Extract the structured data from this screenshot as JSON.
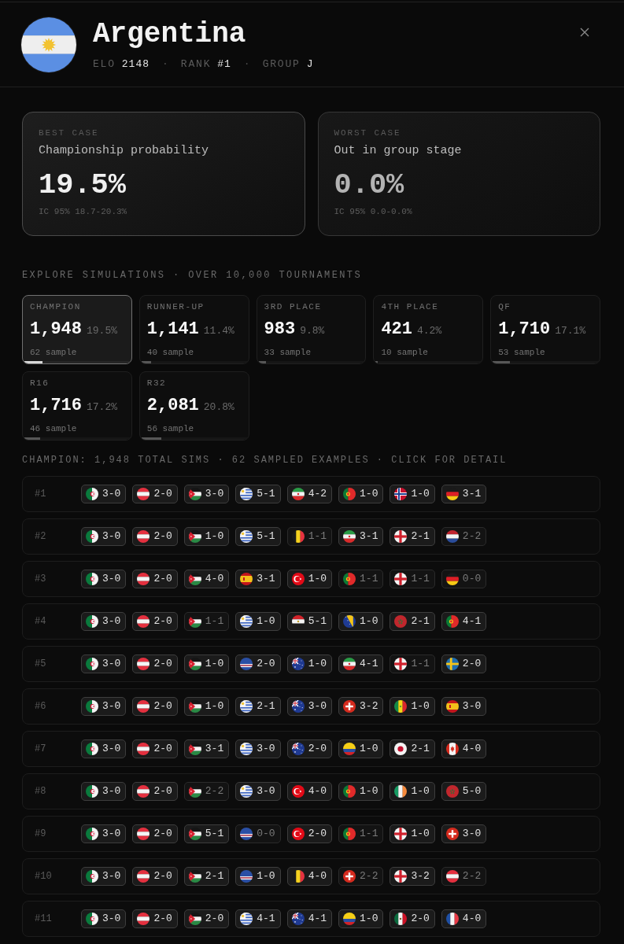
{
  "header": {
    "flag": {
      "kind": "argentina"
    },
    "title": "Argentina",
    "meta": [
      {
        "kind": "stat",
        "label": "ELO",
        "value": "2148"
      },
      {
        "kind": "separator",
        "text": "·"
      },
      {
        "kind": "stat",
        "label": "RANK",
        "value": "#1"
      },
      {
        "kind": "separator",
        "text": "·"
      },
      {
        "kind": "stat",
        "label": "GROUP",
        "value": "J"
      }
    ]
  },
  "cards": [
    {
      "kind": "best",
      "eyebrow": "BEST CASE",
      "title": "Championship probability",
      "value": "19.5%",
      "interval": "IC 95% 18.7-20.3%"
    },
    {
      "kind": "worst",
      "eyebrow": "WORST CASE",
      "title": "Out in group stage",
      "value": "0.0%",
      "interval": "IC 95% 0.0-0.0%"
    }
  ],
  "explore": {
    "heading": "EXPLORE SIMULATIONS · OVER 10,000 TOURNAMENTS",
    "tiles": [
      {
        "label": "CHAMPION",
        "count": "1,948",
        "share": "19.5%",
        "sample": "62 sample",
        "selected": true,
        "level": 0.17
      },
      {
        "label": "RUNNER-UP",
        "count": "1,141",
        "share": "11.4%",
        "sample": "40 sample",
        "selected": false,
        "level": 0.09
      },
      {
        "label": "3RD PLACE",
        "count": "983",
        "share": "9.8%",
        "sample": "33 sample",
        "selected": false,
        "level": 0.07
      },
      {
        "label": "4TH PLACE",
        "count": "421",
        "share": "4.2%",
        "sample": "10 sample",
        "selected": false,
        "level": 0.02
      },
      {
        "label": "QF",
        "count": "1,710",
        "share": "17.1%",
        "sample": "53 sample",
        "selected": false,
        "level": 0.16
      },
      {
        "label": "R16",
        "count": "1,716",
        "share": "17.2%",
        "sample": "46 sample",
        "selected": false,
        "level": 0.15
      },
      {
        "label": "R32",
        "count": "2,081",
        "share": "20.8%",
        "sample": "56 sample",
        "selected": false,
        "level": 0.19
      }
    ]
  },
  "summary": "CHAMPION: 1,948 TOTAL SIMS · 62 SAMPLED EXAMPLES · CLICK FOR DETAIL",
  "simulations": [
    {
      "label": "#1",
      "matches": [
        {
          "kind": "algeria",
          "score": "3-0",
          "draw": false
        },
        {
          "kind": "austria",
          "score": "2-0",
          "draw": false
        },
        {
          "kind": "jordan",
          "score": "3-0",
          "draw": false
        },
        {
          "kind": "uruguay",
          "score": "5-1",
          "draw": false
        },
        {
          "kind": "iran",
          "score": "4-2",
          "draw": false
        },
        {
          "kind": "portugal",
          "score": "1-0",
          "draw": false
        },
        {
          "kind": "norway",
          "score": "1-0",
          "draw": false
        },
        {
          "kind": "germany",
          "score": "3-1",
          "draw": false
        }
      ]
    },
    {
      "label": "#2",
      "matches": [
        {
          "kind": "algeria",
          "score": "3-0",
          "draw": false
        },
        {
          "kind": "austria",
          "score": "2-0",
          "draw": false
        },
        {
          "kind": "jordan",
          "score": "1-0",
          "draw": false
        },
        {
          "kind": "uruguay",
          "score": "5-1",
          "draw": false
        },
        {
          "kind": "belgium",
          "score": "1-1",
          "draw": true
        },
        {
          "kind": "iran",
          "score": "3-1",
          "draw": false
        },
        {
          "kind": "england",
          "score": "2-1",
          "draw": false
        },
        {
          "kind": "netherlands",
          "score": "2-2",
          "draw": true
        }
      ]
    },
    {
      "label": "#3",
      "matches": [
        {
          "kind": "algeria",
          "score": "3-0",
          "draw": false
        },
        {
          "kind": "austria",
          "score": "2-0",
          "draw": false
        },
        {
          "kind": "jordan",
          "score": "4-0",
          "draw": false
        },
        {
          "kind": "spain",
          "score": "3-1",
          "draw": false
        },
        {
          "kind": "turkey",
          "score": "1-0",
          "draw": false
        },
        {
          "kind": "portugal",
          "score": "1-1",
          "draw": true
        },
        {
          "kind": "england",
          "score": "1-1",
          "draw": true
        },
        {
          "kind": "germany",
          "score": "0-0",
          "draw": true
        }
      ]
    },
    {
      "label": "#4",
      "matches": [
        {
          "kind": "algeria",
          "score": "3-0",
          "draw": false
        },
        {
          "kind": "austria",
          "score": "2-0",
          "draw": false
        },
        {
          "kind": "jordan",
          "score": "1-1",
          "draw": true
        },
        {
          "kind": "uruguay",
          "score": "1-0",
          "draw": false
        },
        {
          "kind": "egypt",
          "score": "5-1",
          "draw": false
        },
        {
          "kind": "bosnia",
          "score": "1-0",
          "draw": false
        },
        {
          "kind": "morocco",
          "score": "2-1",
          "draw": false
        },
        {
          "kind": "portugal",
          "score": "4-1",
          "draw": false
        }
      ]
    },
    {
      "label": "#5",
      "matches": [
        {
          "kind": "algeria",
          "score": "3-0",
          "draw": false
        },
        {
          "kind": "austria",
          "score": "2-0",
          "draw": false
        },
        {
          "kind": "jordan",
          "score": "1-0",
          "draw": false
        },
        {
          "kind": "capeverde",
          "score": "2-0",
          "draw": false
        },
        {
          "kind": "australia",
          "score": "1-0",
          "draw": false
        },
        {
          "kind": "iran",
          "score": "4-1",
          "draw": false
        },
        {
          "kind": "england",
          "score": "1-1",
          "draw": true
        },
        {
          "kind": "sweden",
          "score": "2-0",
          "draw": false
        }
      ]
    },
    {
      "label": "#6",
      "matches": [
        {
          "kind": "algeria",
          "score": "3-0",
          "draw": false
        },
        {
          "kind": "austria",
          "score": "2-0",
          "draw": false
        },
        {
          "kind": "jordan",
          "score": "1-0",
          "draw": false
        },
        {
          "kind": "uruguay",
          "score": "2-1",
          "draw": false
        },
        {
          "kind": "australia",
          "score": "3-0",
          "draw": false
        },
        {
          "kind": "switzerland",
          "score": "3-2",
          "draw": false
        },
        {
          "kind": "senegal",
          "score": "1-0",
          "draw": false
        },
        {
          "kind": "spain",
          "score": "3-0",
          "draw": false
        }
      ]
    },
    {
      "label": "#7",
      "matches": [
        {
          "kind": "algeria",
          "score": "3-0",
          "draw": false
        },
        {
          "kind": "austria",
          "score": "2-0",
          "draw": false
        },
        {
          "kind": "jordan",
          "score": "3-1",
          "draw": false
        },
        {
          "kind": "uruguay",
          "score": "3-0",
          "draw": false
        },
        {
          "kind": "australia",
          "score": "2-0",
          "draw": false
        },
        {
          "kind": "colombia",
          "score": "1-0",
          "draw": false
        },
        {
          "kind": "japan",
          "score": "2-1",
          "draw": false
        },
        {
          "kind": "canada",
          "score": "4-0",
          "draw": false
        }
      ]
    },
    {
      "label": "#8",
      "matches": [
        {
          "kind": "algeria",
          "score": "3-0",
          "draw": false
        },
        {
          "kind": "austria",
          "score": "2-0",
          "draw": false
        },
        {
          "kind": "jordan",
          "score": "2-2",
          "draw": true
        },
        {
          "kind": "uruguay",
          "score": "3-0",
          "draw": false
        },
        {
          "kind": "turkey",
          "score": "4-0",
          "draw": false
        },
        {
          "kind": "portugal",
          "score": "1-0",
          "draw": false
        },
        {
          "kind": "ireland",
          "score": "1-0",
          "draw": false
        },
        {
          "kind": "morocco",
          "score": "5-0",
          "draw": false
        }
      ]
    },
    {
      "label": "#9",
      "matches": [
        {
          "kind": "algeria",
          "score": "3-0",
          "draw": false
        },
        {
          "kind": "austria",
          "score": "2-0",
          "draw": false
        },
        {
          "kind": "jordan",
          "score": "5-1",
          "draw": false
        },
        {
          "kind": "capeverde",
          "score": "0-0",
          "draw": true
        },
        {
          "kind": "turkey",
          "score": "2-0",
          "draw": false
        },
        {
          "kind": "portugal",
          "score": "1-1",
          "draw": true
        },
        {
          "kind": "england",
          "score": "1-0",
          "draw": false
        },
        {
          "kind": "switzerland",
          "score": "3-0",
          "draw": false
        }
      ]
    },
    {
      "label": "#10",
      "matches": [
        {
          "kind": "algeria",
          "score": "3-0",
          "draw": false
        },
        {
          "kind": "austria",
          "score": "2-0",
          "draw": false
        },
        {
          "kind": "jordan",
          "score": "2-1",
          "draw": false
        },
        {
          "kind": "capeverde",
          "score": "1-0",
          "draw": false
        },
        {
          "kind": "belgium",
          "score": "4-0",
          "draw": false
        },
        {
          "kind": "switzerland",
          "score": "2-2",
          "draw": true
        },
        {
          "kind": "england",
          "score": "3-2",
          "draw": false
        },
        {
          "kind": "austria",
          "score": "2-2",
          "draw": true
        }
      ]
    },
    {
      "label": "#11",
      "matches": [
        {
          "kind": "algeria",
          "score": "3-0",
          "draw": false
        },
        {
          "kind": "austria",
          "score": "2-0",
          "draw": false
        },
        {
          "kind": "jordan",
          "score": "2-0",
          "draw": false
        },
        {
          "kind": "uruguay",
          "score": "4-1",
          "draw": false
        },
        {
          "kind": "australia",
          "score": "4-1",
          "draw": false
        },
        {
          "kind": "colombia",
          "score": "1-0",
          "draw": false
        },
        {
          "kind": "mexico",
          "score": "2-0",
          "draw": false
        },
        {
          "kind": "france",
          "score": "4-0",
          "draw": false
        }
      ]
    }
  ]
}
